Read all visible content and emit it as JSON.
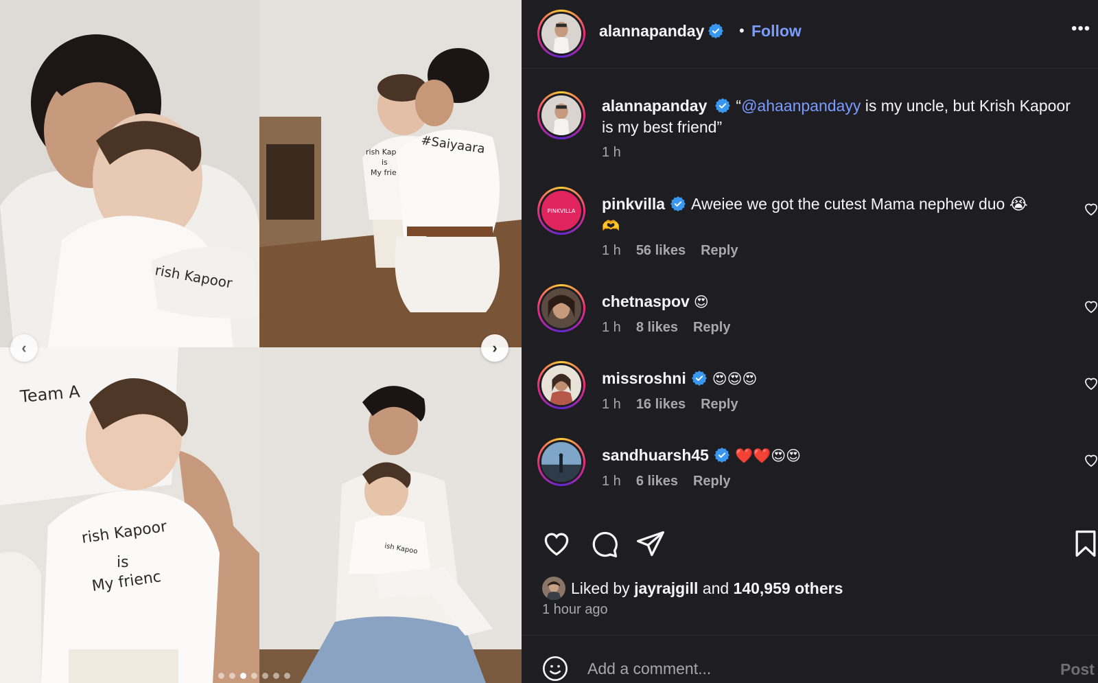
{
  "post": {
    "author": "alannapanday",
    "follow_label": "Follow",
    "separator": "•",
    "more_label": "•••",
    "caption_prefix": "“",
    "caption_mention": "@ahaanpandayy",
    "caption_rest": " is my uncle, but Krish Kapoor is my best friend”",
    "caption_time": "1 h"
  },
  "media": {
    "photo_texts": [
      "Team A",
      "rish Kapoor",
      "is",
      "My frienc",
      "#Saiyaara",
      "rish Kap",
      "is",
      "My frie",
      "ish Kapoo"
    ],
    "slide_count": 7,
    "active_slide": 2
  },
  "comments": [
    {
      "user": "pinkvilla",
      "verified": true,
      "avatar_text": "PINKVILLA",
      "text": "Aweiee we got the cutest Mama nephew duo 😭",
      "text2": "🫶",
      "time": "1 h",
      "likes": "56 likes",
      "reply": "Reply"
    },
    {
      "user": "chetnaspov",
      "verified": false,
      "text": "😍",
      "time": "1 h",
      "likes": "8 likes",
      "reply": "Reply"
    },
    {
      "user": "missroshni",
      "verified": true,
      "text": "😍😍😍",
      "time": "1 h",
      "likes": "16 likes",
      "reply": "Reply"
    },
    {
      "user": "sandhuarsh45",
      "verified": true,
      "text": "❤️❤️😍😍",
      "time": "1 h",
      "likes": "6 likes",
      "reply": "Reply"
    }
  ],
  "likes": {
    "prefix": "Liked by",
    "user": "jayrajgill",
    "middle": "and",
    "count": "140,959 others"
  },
  "time_ago": "1 hour ago",
  "composer": {
    "placeholder": "Add a comment...",
    "post_label": "Post"
  },
  "colors": {
    "panel_bg": "#1e1e22",
    "link_blue": "#7a9cff",
    "verified_blue": "#3897f0",
    "muted_text": "#a8a8a8"
  }
}
